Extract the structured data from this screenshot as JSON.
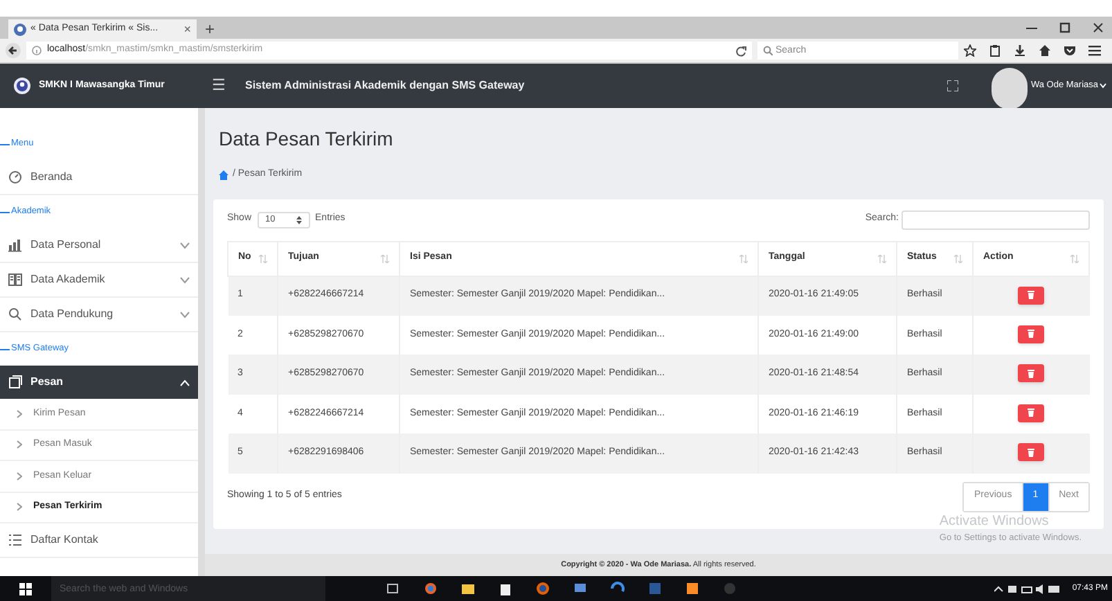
{
  "browser": {
    "tab_title": "« Data Pesan Terkirim « Sis...",
    "tab_close": "×",
    "new_tab": "+",
    "url_host": "localhost",
    "url_path": "/smkn_mastim/smkn_mastim/smsterkirim",
    "search_placeholder": "Search"
  },
  "header": {
    "brand": "SMKN I Mawasangka Timur",
    "menu_glyph": "☰",
    "app_title": "Sistem Administrasi Akademik dengan SMS Gateway",
    "user": "Wa Ode Mariasa"
  },
  "sidebar": [
    {
      "kind": "section",
      "label": "Menu"
    },
    {
      "kind": "item",
      "label": "Beranda",
      "selected": false
    },
    {
      "kind": "section",
      "label": "Akademik"
    },
    {
      "kind": "item",
      "label": "Data Personal",
      "selected": false,
      "expanded": false
    },
    {
      "kind": "item",
      "label": "Data Akademik",
      "selected": false,
      "expanded": false
    },
    {
      "kind": "item",
      "label": "Data Pendukung",
      "selected": false,
      "expanded": false
    },
    {
      "kind": "section",
      "label": "SMS Gateway"
    },
    {
      "kind": "item",
      "label": "Pesan",
      "selected": true,
      "expanded": true,
      "children": [
        {
          "label": "Kirim Pesan",
          "selected": false
        },
        {
          "label": "Pesan Masuk",
          "selected": false
        },
        {
          "label": "Pesan Keluar",
          "selected": false
        },
        {
          "label": "Pesan Terkirim",
          "selected": true
        }
      ]
    },
    {
      "kind": "item",
      "label": "Daftar Kontak",
      "selected": false
    }
  ],
  "page": {
    "title": "Data Pesan Terkirim",
    "breadcrumb": "/ Pesan Terkirim"
  },
  "table_controls": {
    "show": "Show",
    "page_size": "10",
    "entries": "Entries",
    "search_label": "Search:"
  },
  "table": {
    "columns": [
      "No",
      "Tujuan",
      "Isi Pesan",
      "Tanggal",
      "Status",
      "Action"
    ],
    "rows": [
      {
        "no": "1",
        "tujuan": "+6282246667214",
        "isi": "Semester: Semester Ganjil 2019/2020 Mapel: Pendidikan...",
        "tanggal": "2020-01-16 21:49:05",
        "status": "Berhasil"
      },
      {
        "no": "2",
        "tujuan": "+6285298270670",
        "isi": "Semester: Semester Ganjil 2019/2020 Mapel: Pendidikan...",
        "tanggal": "2020-01-16 21:49:00",
        "status": "Berhasil"
      },
      {
        "no": "3",
        "tujuan": "+6285298270670",
        "isi": "Semester: Semester Ganjil 2019/2020 Mapel: Pendidikan...",
        "tanggal": "2020-01-16 21:48:54",
        "status": "Berhasil"
      },
      {
        "no": "4",
        "tujuan": "+6282246667214",
        "isi": "Semester: Semester Ganjil 2019/2020 Mapel: Pendidikan...",
        "tanggal": "2020-01-16 21:46:19",
        "status": "Berhasil"
      },
      {
        "no": "5",
        "tujuan": "+6282291698406",
        "isi": "Semester: Semester Ganjil 2019/2020 Mapel: Pendidikan...",
        "tanggal": "2020-01-16 21:42:43",
        "status": "Berhasil"
      }
    ]
  },
  "info": "Showing 1 to 5 of 5 entries",
  "pagination": [
    {
      "label": "Previous",
      "selected": false
    },
    {
      "label": "1",
      "selected": true
    },
    {
      "label": "Next",
      "selected": false
    }
  ],
  "activation": {
    "title": "Activate Windows",
    "hint": "Go to Settings to activate Windows."
  },
  "footer": {
    "text": "**Copyright © 2020 - Wa Ode Mariasa.** All rights reserved."
  },
  "taskbar": {
    "search_placeholder": "Search the web and Windows",
    "time": "07:43 PM"
  }
}
